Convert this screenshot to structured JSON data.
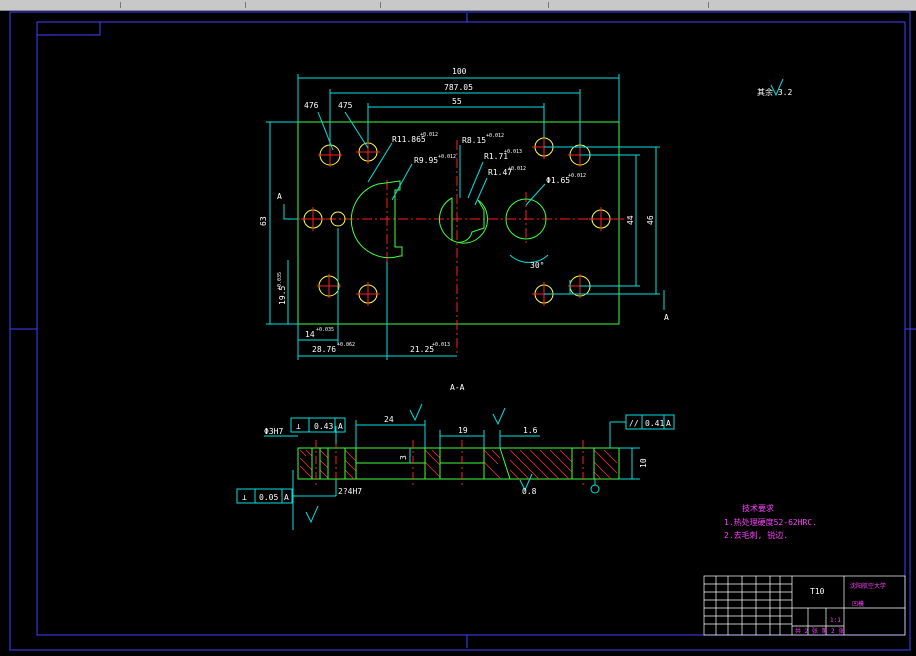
{
  "colors": {
    "background": "#000000",
    "frame": "#4040ff",
    "part_outline": "#40ff40",
    "dimension": "#00e0e0",
    "centerline": "#ff2020",
    "hole": "#ffff40",
    "hatch": "#ff3030",
    "notes": "#ff40ff",
    "text": "#ffffff"
  },
  "top_view": {
    "dimensions": {
      "overall_width": "100",
      "width_787": "787.05",
      "width_55": "55",
      "dim_476": "476",
      "dim_475": "475",
      "r_11865": "R11.865",
      "r_11865_tol": "+0.012",
      "r_815": "R8.15",
      "r_815_tol": "+0.012",
      "r_995": "R9.95",
      "r_995_tol": "+0.012",
      "r_171": "R1.71",
      "r_171_tol": "+0.013",
      "r_147": "R1.47",
      "r_147_tol": "+0.012",
      "phi_165": "Φ1.65",
      "phi_165_tol": "+0.012",
      "height_63": "63",
      "dim_44": "44",
      "dim_46": "46",
      "dim_195": "19.5",
      "dim_195_tol": "+0.035",
      "dim_14": "14",
      "dim_14_tol": "+0.035",
      "dim_2876": "28.76",
      "dim_2876_tol": "+0.062",
      "dim_2125": "21.25",
      "dim_2125_tol": "+0.013",
      "angle_30": "30°"
    },
    "section_marker": "A",
    "roughness": "其余 3.2"
  },
  "section_view": {
    "title": "A-A",
    "dimensions": {
      "dim_24": "24",
      "dim_19": "19",
      "dim_16": "1.6",
      "dim_10": "10",
      "dim_3": "3",
      "phi_3h7": "Φ3H7",
      "holes_2_4h7": "2?4H7",
      "roughness_08": "0.8"
    },
    "tolerances": {
      "perpendicularity_top": {
        "symbol": "⊥",
        "value": "0.43",
        "datum": "A"
      },
      "perpendicularity_bottom": {
        "symbol": "⊥",
        "value": "0.05",
        "datum": "A"
      },
      "parallelism": {
        "symbol": "//",
        "value": "0.41",
        "datum": "A"
      }
    }
  },
  "notes": {
    "heading": "技术要求",
    "line1": "1.热处理硬度52-62HRC.",
    "line2": "2.去毛刺, 锐边."
  },
  "title_block": {
    "material": "T10",
    "school": "沈阳航空大学",
    "part_name": "凹模",
    "scale": "1:1",
    "sheet": "共 2 张 第 2 张"
  }
}
